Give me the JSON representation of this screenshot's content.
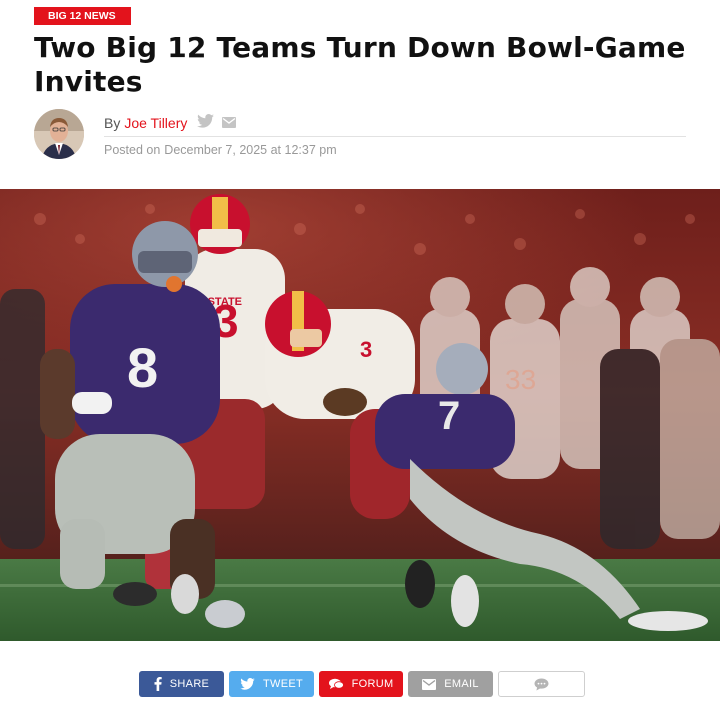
{
  "category": {
    "label": "BIG 12 NEWS"
  },
  "article": {
    "title": "Two Big 12 Teams Turn Down Bowl-Game Invites",
    "by_label": "By",
    "author": "Joe Tillery",
    "posted_label": "Posted on",
    "date": "December 7, 2025 at 12:37 pm"
  },
  "hero": {
    "home_team_colors": {
      "jersey": "#3b2a6e",
      "pants": "#b9bfb8"
    },
    "away_team_colors": {
      "jersey": "#f2efe9",
      "helmet": "#c8102e",
      "pants": "#a0262b"
    },
    "field_color": "#3f6e3a",
    "jersey_numbers": [
      "8",
      "3",
      "7"
    ],
    "jersey_text": "A STATE"
  },
  "share": {
    "facebook": "SHARE",
    "twitter": "TWEET",
    "forum": "FORUM",
    "email": "EMAIL"
  },
  "colors": {
    "accent": "#e3131c",
    "facebook": "#3b5998",
    "twitter": "#55acee",
    "email": "#a0a0a0"
  }
}
